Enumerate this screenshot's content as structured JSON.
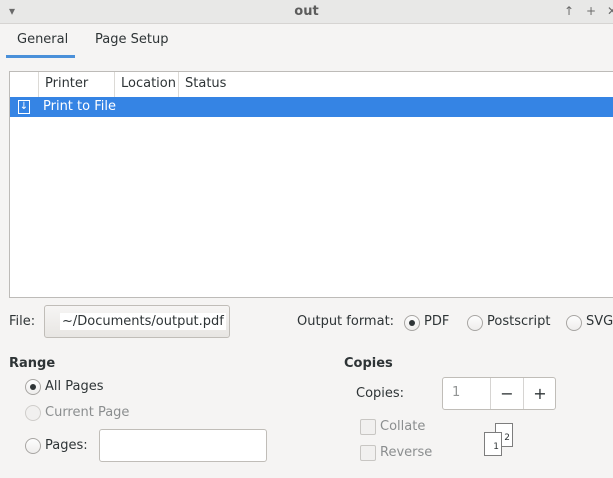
{
  "window": {
    "title": "out"
  },
  "tabs": [
    {
      "label": "General"
    },
    {
      "label": "Page Setup"
    }
  ],
  "printer_list": {
    "columns": [
      "Printer",
      "Location",
      "Status"
    ],
    "rows": [
      {
        "name": "Print to File",
        "location": "",
        "status": ""
      }
    ]
  },
  "file": {
    "label": "File:",
    "value": "~/Documents/output.pdf"
  },
  "output_format": {
    "label": "Output format:",
    "options": [
      "PDF",
      "Postscript",
      "SVG"
    ],
    "selected": "PDF"
  },
  "range": {
    "title": "Range",
    "all_pages": "All Pages",
    "current_page": "Current Page",
    "pages": "Pages:",
    "pages_value": ""
  },
  "copies": {
    "title": "Copies",
    "label": "Copies:",
    "value": "1",
    "collate": "Collate",
    "reverse": "Reverse",
    "minus": "−",
    "plus": "+",
    "sheet_back": "2",
    "sheet_front": "1"
  }
}
